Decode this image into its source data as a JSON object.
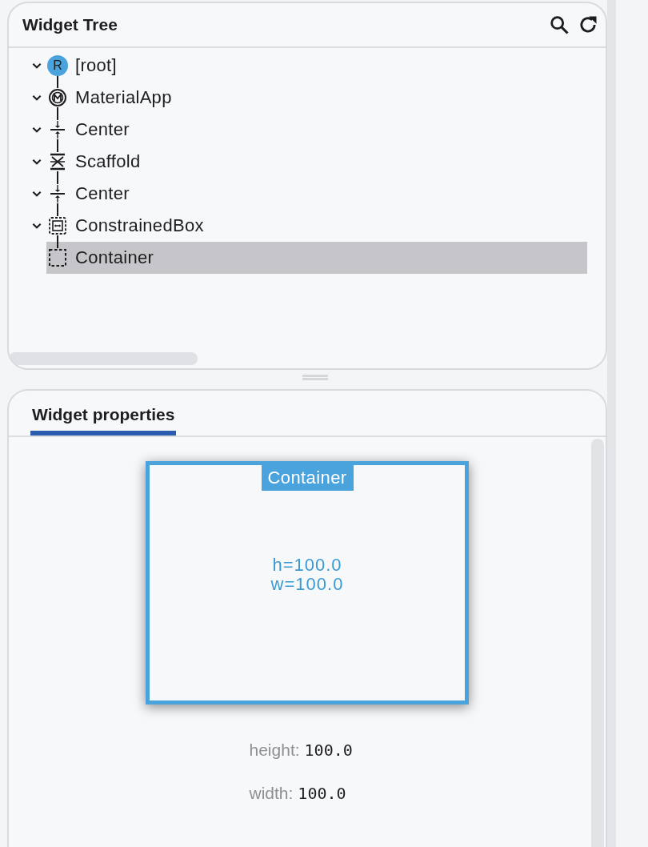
{
  "widget_tree": {
    "title": "Widget Tree",
    "nodes": [
      {
        "label": "[root]",
        "kind": "root",
        "badge": "R",
        "expanded": true,
        "selected": false,
        "children": [
          {
            "label": "MaterialApp",
            "kind": "material",
            "expanded": true,
            "selected": false,
            "children": [
              {
                "label": "Center",
                "kind": "center",
                "expanded": true,
                "selected": false,
                "children": [
                  {
                    "label": "Scaffold",
                    "kind": "scaffold",
                    "expanded": true,
                    "selected": false,
                    "children": [
                      {
                        "label": "Center",
                        "kind": "center",
                        "expanded": true,
                        "selected": false,
                        "children": [
                          {
                            "label": "ConstrainedBox",
                            "kind": "constrained",
                            "expanded": true,
                            "selected": false,
                            "children": [
                              {
                                "label": "Container",
                                "kind": "container",
                                "selected": true
                              }
                            ]
                          }
                        ]
                      }
                    ]
                  }
                ]
              }
            ]
          }
        ]
      }
    ]
  },
  "properties": {
    "tabs": [
      {
        "label": "Widget properties",
        "selected": true
      }
    ],
    "preview": {
      "label": "Container",
      "height_text": "h=100.0",
      "width_text": "w=100.0"
    },
    "rows": [
      {
        "name": "height:",
        "value": "100.0"
      },
      {
        "name": "width:",
        "value": "100.0"
      }
    ]
  }
}
